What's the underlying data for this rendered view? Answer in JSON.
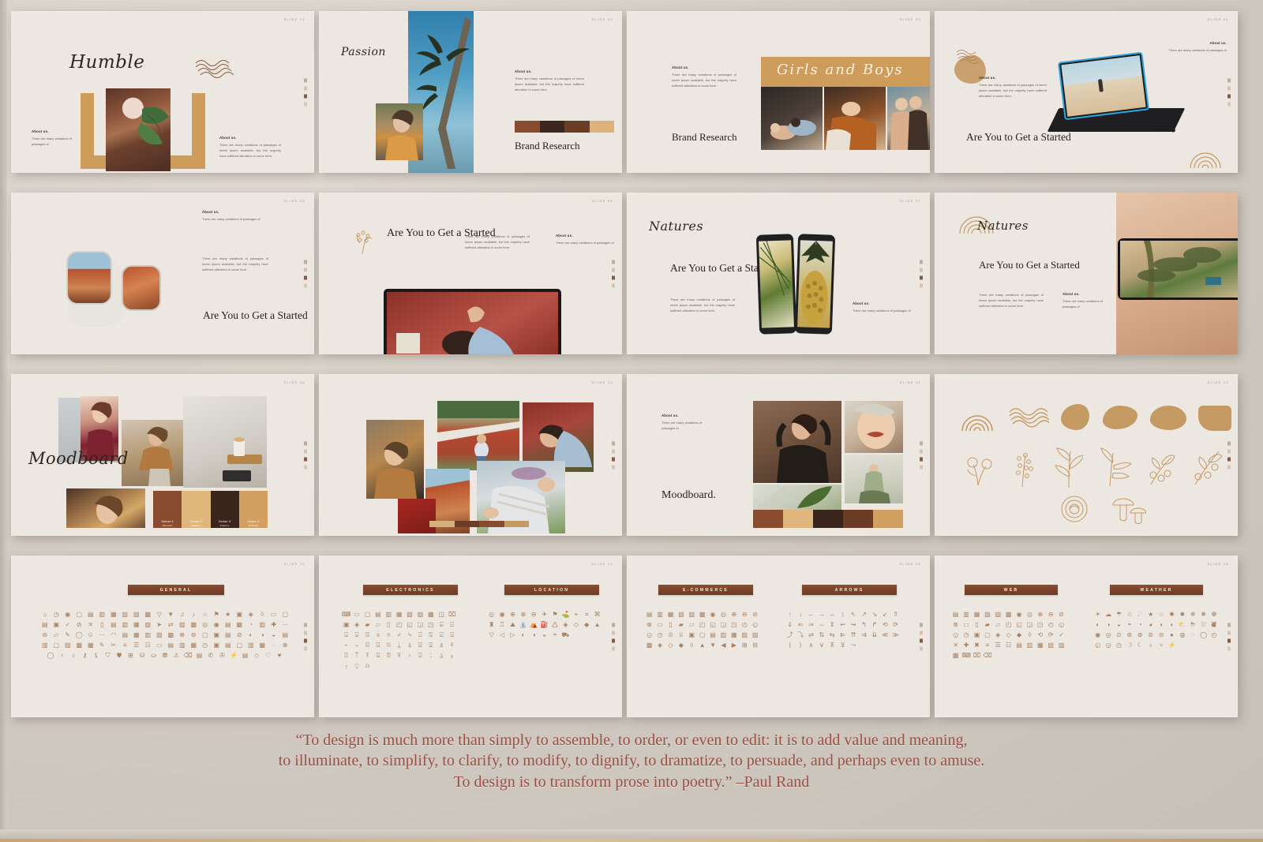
{
  "meta": {
    "background_color": "#d4cdc4",
    "slide_bg": "#efeae3",
    "accent_brown": "#7c4a2a",
    "accent_tan": "#c79a62",
    "quote_color": "#9a4f43"
  },
  "common": {
    "about_heading": "About us.",
    "about_short": "There are many variations of passages of",
    "about_long": "There are many variations of passages of lorem ipsum available, but the majority have suffered alteration in some form.",
    "heading_started": "Are You to Get a Started",
    "brand_research": "Brand Research"
  },
  "slides": [
    {
      "id": "slide-humble",
      "number": "SLIDE 01",
      "title": "Humble",
      "title_style": "script",
      "about_heading": "About us.",
      "about_short": "There are many variations of passages of",
      "about_long": "There are many variations of passages of lorem ipsum available, but the majority have suffered alteration in some form."
    },
    {
      "id": "slide-passion",
      "number": "SLIDE 02",
      "title": "Passion",
      "title_style": "script",
      "subtitle": "Brand Research",
      "about_heading": "About us.",
      "about_long": "There are many variations of passages of lorem ipsum available, but the majority have suffered alteration in some form.",
      "palette": [
        "#8a4a2c",
        "#3a231a",
        "#6b3b23",
        "#dfb37a"
      ]
    },
    {
      "id": "slide-girls-and-boys",
      "number": "SLIDE 03",
      "title": "Girls and Boys",
      "title_style": "script",
      "subtitle": "Brand Research",
      "about_heading": "About us.",
      "about_long": "There are many variations of passages of lorem ipsum available, but the majority have suffered alteration in some form."
    },
    {
      "id": "slide-tablet",
      "number": "SLIDE 04",
      "title": "Are You to Get a Started",
      "title_style": "serif",
      "about_heading": "About us.",
      "about_short": "There are many variations of passages of",
      "about_long": "There are many variations of passages of lorem ipsum available, but the majority have suffered alteration in some form."
    },
    {
      "id": "slide-watch",
      "number": "SLIDE 05",
      "title": "Are You to Get a Started",
      "title_style": "serif",
      "about_heading": "About us.",
      "about_short": "There are many variations of passages of",
      "about_long": "There are many variations of passages of lorem ipsum available, but the majority have suffered alteration in some form."
    },
    {
      "id": "slide-laptop",
      "number": "SLIDE 06",
      "title": "Are You to Get a Started",
      "title_style": "serif",
      "about_heading": "About us.",
      "about_short": "There are many variations of passages of",
      "about_long": "There are many variations of passages of lorem ipsum available, but the majority have suffered alteration in some form."
    },
    {
      "id": "slide-natures-phones",
      "number": "SLIDE 07",
      "title": "Natures",
      "title_style": "script",
      "subtitle": "Are You to Get a Started",
      "about_heading": "About us.",
      "about_short": "There are many variations of passages of",
      "about_long": "There are many variations of passages of lorem ipsum available, but the majority have suffered alteration in some form."
    },
    {
      "id": "slide-natures-hand",
      "number": "SLIDE 08",
      "title": "Natures",
      "title_style": "script",
      "subtitle": "Are You to Get a Started",
      "about_heading": "About us.",
      "about_short": "There are many variations of passages of",
      "about_long": "There are many variations of passages of lorem ipsum available, but the majority have suffered alteration in some form."
    },
    {
      "id": "slide-moodboard-script",
      "number": "SLIDE 09",
      "title": "Moodboard",
      "title_style": "script",
      "swatches": [
        {
          "name": "Colour 1",
          "hex": "#8A4A2C"
        },
        {
          "name": "Colour 2",
          "hex": "#E2B87C"
        },
        {
          "name": "Colour 3",
          "hex": "#38221A"
        },
        {
          "name": "Colour 4",
          "hex": "#D3A161"
        }
      ]
    },
    {
      "id": "slide-photo-collage",
      "number": "SLIDE 10",
      "title": "",
      "palette": [
        "#d9b27c",
        "#6b3b23",
        "#8a4a2c",
        "#c79a62"
      ]
    },
    {
      "id": "slide-moodboard-serif",
      "number": "SLIDE 11",
      "title": "Moodboard.",
      "title_style": "serif",
      "about_heading": "About us.",
      "about_short": "There are many variations of passages of",
      "palette": [
        "#8a4a2c",
        "#e2b87c",
        "#38221a",
        "#6b3b23",
        "#d3a161"
      ]
    },
    {
      "id": "slide-elements",
      "number": "SLIDE 12",
      "title": "",
      "element_rows": [
        [
          "rainbow-arcs-icon",
          "wavy-lines-icon",
          "blob-shape-1",
          "blob-shape-2",
          "blob-shape-3",
          "blob-shape-4"
        ],
        [
          "flower-sprig-icon",
          "wheat-sprig-icon",
          "leaf-branch-icon",
          "grass-sprig-icon",
          "berry-branch-icon",
          "vine-branch-icon"
        ],
        [
          "rose-bloom-icon",
          "mushrooms-icon"
        ]
      ]
    }
  ],
  "icon_slides": [
    {
      "id": "slide-icons-general",
      "number": "SLIDE 13",
      "categories": [
        {
          "label": "GENERAL",
          "count": 104
        }
      ]
    },
    {
      "id": "slide-icons-electronics-location",
      "number": "SLIDE 14",
      "categories": [
        {
          "label": "ELECTRONICS",
          "count": 58
        },
        {
          "label": "LOCATION",
          "count": 30
        }
      ]
    },
    {
      "id": "slide-icons-ecommerce-arrows",
      "number": "SLIDE 15",
      "categories": [
        {
          "label": "E-COMMERCE",
          "count": 44
        },
        {
          "label": "ARROWS",
          "count": 40
        }
      ]
    },
    {
      "id": "slide-icons-web-weather",
      "number": "SLIDE 16",
      "categories": [
        {
          "label": "WEB",
          "count": 48
        },
        {
          "label": "WEATHER",
          "count": 44
        }
      ]
    }
  ],
  "icon_glyphs": {
    "general": [
      "⌂",
      "◷",
      "◉",
      "▢",
      "▤",
      "▥",
      "▦",
      "▧",
      "▨",
      "▩",
      "▽",
      "▼",
      "♫",
      "♪",
      "☆",
      "⚑",
      "★",
      "▣",
      "◈",
      "◊",
      "▭",
      "▢",
      "▤",
      "▣",
      "✓",
      "⊘",
      "✕",
      "▯",
      "▤",
      "▥",
      "▦",
      "▧",
      "➤",
      "⇄",
      "▨",
      "▩",
      "◎",
      "◉",
      "▤",
      "▦",
      "◔",
      "▥",
      "✚",
      "⋯",
      "⊖",
      "▱",
      "✎",
      "◯",
      "☺",
      "⋯",
      "◠",
      "▤",
      "▦",
      "▥",
      "▨",
      "▩",
      "⊕",
      "⊖",
      "▢",
      "▣",
      "▤",
      "⊘",
      "◐",
      "◑",
      "◒",
      "▤",
      "▥",
      "▢",
      "▨",
      "▩",
      "▦",
      "✎",
      "✂",
      "≡",
      "☰",
      "☷",
      "▭",
      "▤",
      "▥",
      "▦",
      "◷",
      "▣",
      "▤",
      "▢",
      "▥",
      "▦",
      "◌",
      "⊕",
      "◯",
      "♀",
      "♁",
      "⚷",
      "⚸",
      "⛉",
      "⛊",
      "⊞",
      "⛁",
      "⛀",
      "⛃",
      "⚠",
      "⌫",
      "▤",
      "✆",
      "✇",
      "⚡",
      "▤",
      "◇",
      "♡",
      "♥"
    ],
    "electronics": [
      "⌨",
      "▭",
      "▢",
      "▤",
      "▥",
      "▦",
      "▧",
      "▨",
      "▩",
      "◫",
      "⌧",
      "▣",
      "◈",
      "▰",
      "▱",
      "▯",
      "◰",
      "◱",
      "◲",
      "◳",
      "⌸",
      "⌹",
      "⌺",
      "⌻",
      "⌼",
      "⌽",
      "⌾",
      "⌿",
      "⍀",
      "⍁",
      "⍂",
      "⍃",
      "⍄",
      "⍅",
      "⍆",
      "⍇",
      "⍈",
      "⍉",
      "⍊",
      "⍋",
      "⍌",
      "⍍",
      "⍎",
      "⍏",
      "⍐",
      "⍑",
      "⍒",
      "⍓",
      "⍔",
      "⍕",
      "⍖",
      "⍗",
      "⍘",
      "⍙",
      "⍚",
      "⍛",
      "⍜",
      "⍝"
    ],
    "location": [
      "◎",
      "◉",
      "⊕",
      "⊗",
      "⊖",
      "✈",
      "⚑",
      "⛳",
      "⌖",
      "⌗",
      "⌘",
      "♜",
      "♖",
      "⛰",
      "⛲",
      "⛺",
      "⛽",
      "🛆",
      "◈",
      "◇",
      "◆",
      "▲",
      "▽",
      "◁",
      "▷",
      "◐",
      "◑",
      "◒",
      "◓",
      "⛟"
    ],
    "ecommerce": [
      "▤",
      "▥",
      "▦",
      "▧",
      "▨",
      "▩",
      "◉",
      "◎",
      "⊕",
      "⊖",
      "⊘",
      "⊗",
      "▭",
      "▯",
      "▰",
      "▱",
      "◰",
      "◱",
      "◲",
      "◳",
      "◴",
      "◵",
      "◶",
      "◷",
      "♔",
      "♕",
      "▣",
      "▢",
      "▤",
      "▥",
      "▦",
      "▧",
      "▨",
      "▩",
      "◈",
      "◇",
      "◆",
      "◊",
      "▲",
      "▼",
      "◀",
      "▶",
      "⊞",
      "⊟"
    ],
    "arrows": [
      "↑",
      "↓",
      "←",
      "→",
      "↔",
      "↕",
      "↖",
      "↗",
      "↘",
      "↙",
      "⇑",
      "⇓",
      "⇐",
      "⇒",
      "⇔",
      "⇕",
      "↩",
      "↪",
      "↰",
      "↱",
      "⟲",
      "⟳",
      "⤴",
      "⤵",
      "⇄",
      "⇅",
      "⇆",
      "⇇",
      "⇈",
      "⇉",
      "⇊",
      "≪",
      "≫",
      "⟨",
      "⟩",
      "∧",
      "∨",
      "⊼",
      "⊻",
      "⤳"
    ],
    "web": [
      "▤",
      "▥",
      "▦",
      "▧",
      "▨",
      "▩",
      "◉",
      "◎",
      "⊕",
      "⊖",
      "⊘",
      "⊗",
      "▭",
      "▯",
      "▰",
      "▱",
      "◰",
      "◱",
      "◲",
      "◳",
      "◴",
      "◵",
      "◶",
      "◷",
      "▣",
      "▢",
      "◈",
      "◇",
      "◆",
      "◊",
      "⟲",
      "⟳",
      "✓",
      "✕",
      "✚",
      "✖",
      "≡",
      "☰",
      "☷",
      "▤",
      "▥",
      "▦",
      "▧",
      "▨",
      "▩",
      "⌨",
      "⌧",
      "⌫"
    ],
    "weather": [
      "☀",
      "☁",
      "☂",
      "☃",
      "☄",
      "★",
      "☆",
      "✹",
      "✸",
      "❄",
      "❅",
      "❆",
      "◐",
      "◑",
      "◒",
      "◓",
      "◔",
      "◕",
      "◖",
      "◗",
      "⛅",
      "⛈",
      "⛆",
      "⛇",
      "◉",
      "◎",
      "⊙",
      "⊚",
      "⊛",
      "⊜",
      "⊝",
      "●",
      "◍",
      "◌",
      "◯",
      "◴",
      "◵",
      "◶",
      "◷",
      "☽",
      "☾",
      "♁",
      "♆",
      "⚡"
    ]
  },
  "quote": {
    "line1": "“To design is much more than simply to assemble, to order, or even to edit: it is to add value and meaning,",
    "line2": "to illuminate, to simplify, to clarify, to modify, to dignify, to dramatize, to persuade, and perhaps even to amuse.",
    "line3": "To design is to transform prose into poetry.” –Paul Rand"
  }
}
